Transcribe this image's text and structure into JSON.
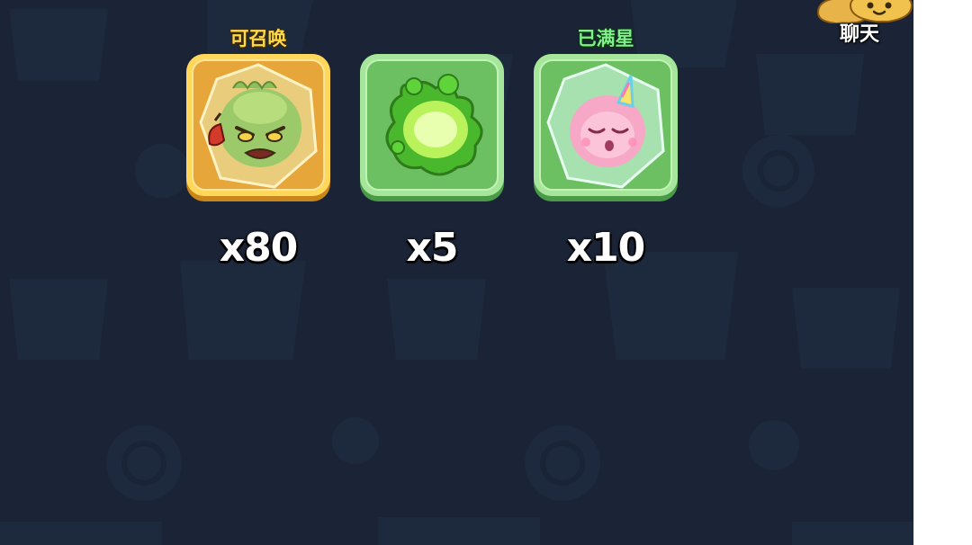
{
  "chat": {
    "label": "聊天",
    "icon": "chat-bubble-icon"
  },
  "items": [
    {
      "status": "可召唤",
      "count": "x80",
      "card_color": "#f4b33a",
      "icon": "cactus-monster-crystal-icon"
    },
    {
      "status": "",
      "count": "x5",
      "card_color": "#7fd47a",
      "icon": "green-slime-blob-icon"
    },
    {
      "status": "已满星",
      "count": "x10",
      "card_color": "#7fd47a",
      "icon": "pink-unicorn-crystal-icon"
    }
  ],
  "colors": {
    "background": "#1a2436",
    "gold_card": "#f4b33a",
    "green_card": "#7fd47a",
    "summon_label": "#ffd84a",
    "full_star_label": "#7ff08a"
  }
}
